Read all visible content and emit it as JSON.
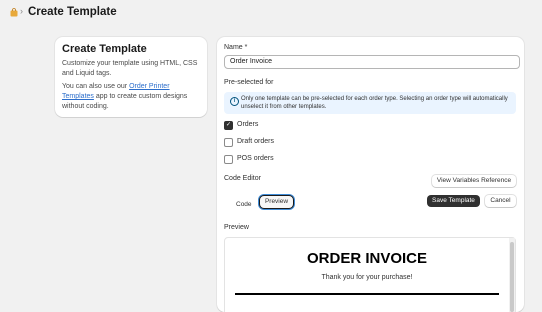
{
  "header": {
    "title": "Create Template",
    "separator": "›",
    "app_icon": "store-bag-icon",
    "app_icon_color": "#e8a93a"
  },
  "info": {
    "title": "Create Template",
    "description": "Customize your template using HTML, CSS and Liquid tags.",
    "custom_prefix": "You can also use our ",
    "link_text": "Order Printer Templates",
    "custom_suffix": " app to create custom designs without coding."
  },
  "form": {
    "name_label": "Name *",
    "name_value": "Order Invoice",
    "preselected_label": "Pre-selected for",
    "banner_icon": "info-icon",
    "banner_text": "Only one template can be pre-selected for each order type. Selecting an order type will automatically unselect it from other templates.",
    "order_types": [
      {
        "label": "Orders",
        "checked": true
      },
      {
        "label": "Draft orders",
        "checked": false
      },
      {
        "label": "POS orders",
        "checked": false
      }
    ],
    "code_editor_label": "Code Editor",
    "view_variables_label": "View Variables Reference",
    "tabs": {
      "code": "Code",
      "preview": "Preview",
      "active": "Preview"
    },
    "save_label": "Save Template",
    "cancel_label": "Cancel",
    "preview_label": "Preview"
  },
  "preview": {
    "invoice_title": "ORDER INVOICE",
    "thank_you": "Thank you for your purchase!"
  },
  "colors": {
    "primary": "#303030",
    "link": "#2c6ecb",
    "banner_bg": "#eaf4ff",
    "background": "#f1f1f1"
  }
}
